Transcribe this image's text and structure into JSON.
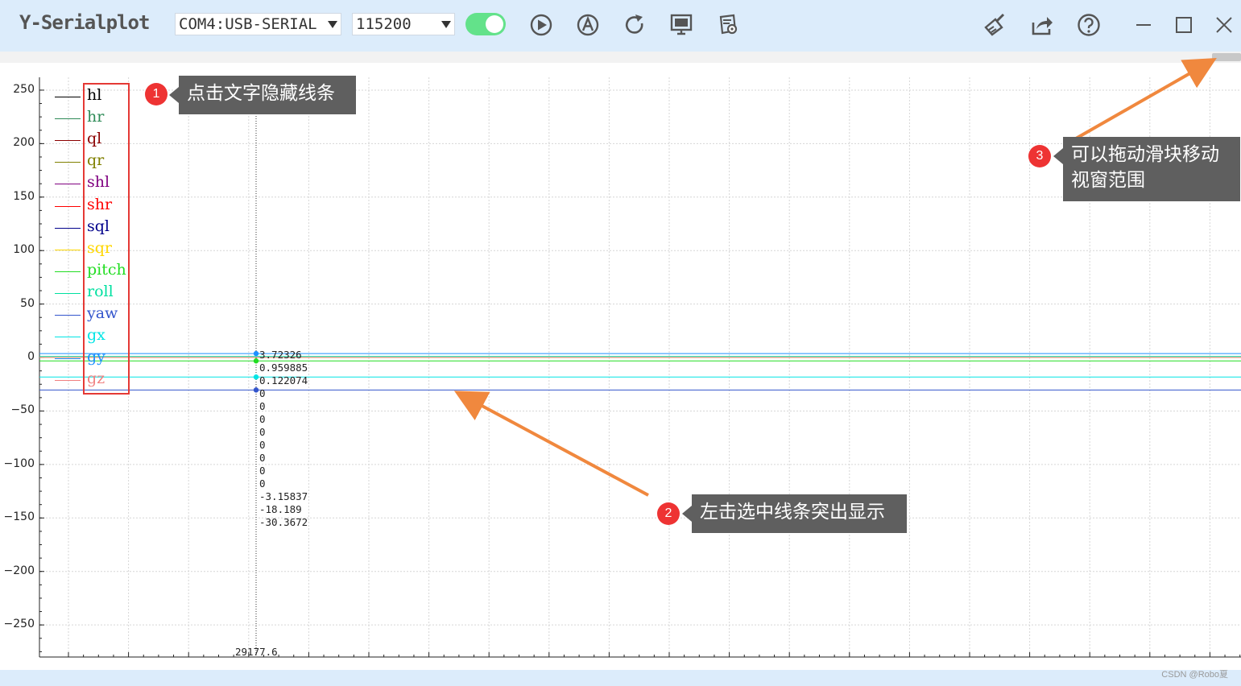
{
  "app": {
    "title": "Y-Serialplot"
  },
  "toolbar": {
    "port": "COM4:USB-SERIAL",
    "baud": "115200",
    "connected": true,
    "icons": [
      "play-icon",
      "auto-scale-icon",
      "refresh-icon",
      "monitor-icon",
      "settings-document-icon",
      "clear-brush-icon",
      "share-icon",
      "help-icon",
      "minimize-icon",
      "maximize-icon",
      "close-icon"
    ]
  },
  "plot": {
    "y_ticks": [
      "250",
      "200",
      "150",
      "100",
      "50",
      "0",
      "-50",
      "-100",
      "-150",
      "-200",
      "-250"
    ],
    "y_range": [
      -280,
      262
    ],
    "cursor_x": "29177.6",
    "cursor_values": [
      "3.72326",
      "0.959885",
      "0.122074",
      "0",
      "0",
      "0",
      "0",
      "0",
      "0",
      "0",
      "0",
      "-3.15837",
      "-18.189",
      "-30.3672"
    ],
    "series": [
      {
        "name": "hl",
        "color": "#000000",
        "value": 0
      },
      {
        "name": "hr",
        "color": "#2e8b57",
        "value": 0
      },
      {
        "name": "ql",
        "color": "#8b0000",
        "value": 0
      },
      {
        "name": "qr",
        "color": "#808000",
        "value": 0
      },
      {
        "name": "shl",
        "color": "#800080",
        "value": 0
      },
      {
        "name": "shr",
        "color": "#ff0000",
        "value": 0
      },
      {
        "name": "sql",
        "color": "#00008b",
        "value": 0
      },
      {
        "name": "sqr",
        "color": "#ffd700",
        "value": 0
      },
      {
        "name": "pitch",
        "color": "#22dd22",
        "value": -3.15837
      },
      {
        "name": "roll",
        "color": "#00e0a0",
        "value": 0.959885
      },
      {
        "name": "yaw",
        "color": "#3355cc",
        "value": -30.3672
      },
      {
        "name": "gx",
        "color": "#00e5e5",
        "value": -18.189
      },
      {
        "name": "gy",
        "color": "#1e90ff",
        "value": 3.72326
      },
      {
        "name": "gz",
        "color": "#f08080",
        "value": 0.122074
      }
    ]
  },
  "annotations": [
    {
      "num": "1",
      "text": "点击文字隐藏线条"
    },
    {
      "num": "2",
      "text": "左击选中线条突出显示"
    },
    {
      "num": "3",
      "line1": "可以拖动滑块移动",
      "line2": "视窗范围"
    }
  ],
  "watermark": "CSDN @Robo夏"
}
